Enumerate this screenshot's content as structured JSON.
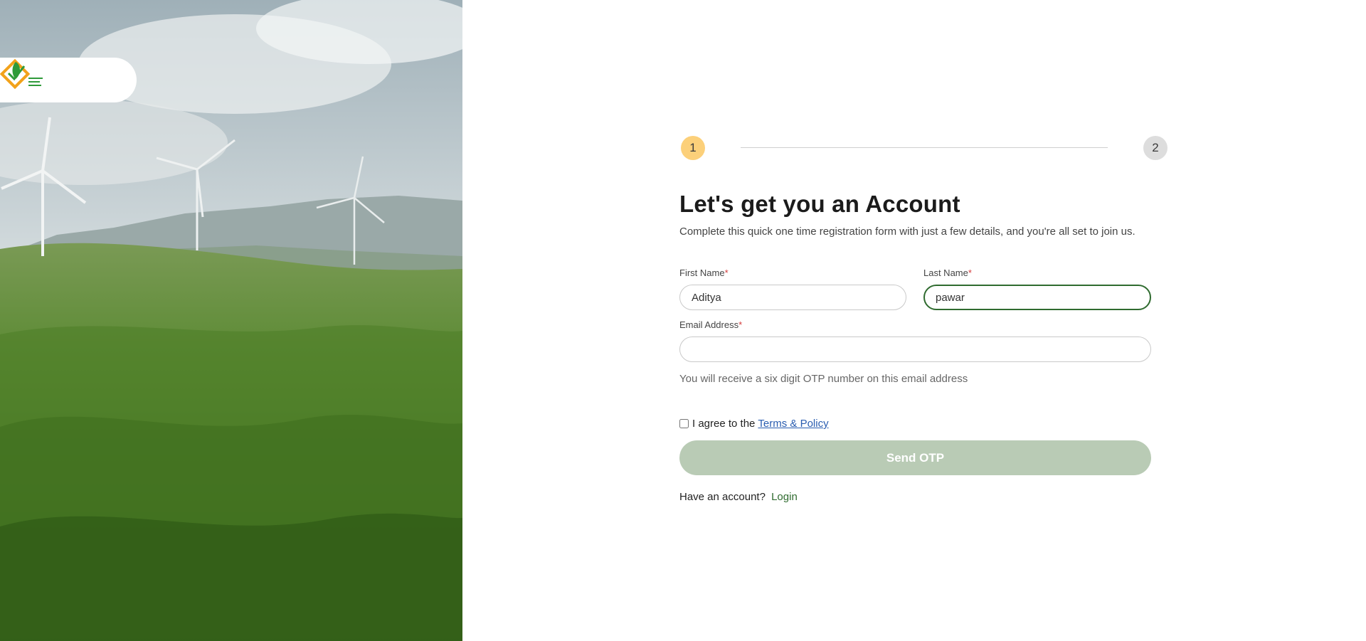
{
  "stepper": {
    "step1": "1",
    "step2": "2"
  },
  "form": {
    "title": "Let's get you an Account",
    "subtitle": "Complete this quick one time registration form with just a few details, and you're all set to join us.",
    "first_name": {
      "label": "First Name",
      "required_mark": "*",
      "value": "Aditya"
    },
    "last_name": {
      "label": "Last Name",
      "required_mark": "*",
      "value": "pawar"
    },
    "email": {
      "label": "Email Address",
      "required_mark": "*",
      "value": ""
    },
    "email_hint": "You will receive a six digit OTP number on this email address",
    "agree_text": "I agree to the",
    "terms_link": "Terms & Policy",
    "submit_label": "Send OTP",
    "login_prompt": "Have an account?",
    "login_link": "Login"
  },
  "colors": {
    "accent_green": "#2f6b2f",
    "step_active": "#fcd07a",
    "step_inactive": "#dddddd",
    "button_disabled": "#b9cbb5",
    "link_blue": "#2a5db0"
  },
  "icons": {
    "logo": "leaf-check-logo"
  }
}
